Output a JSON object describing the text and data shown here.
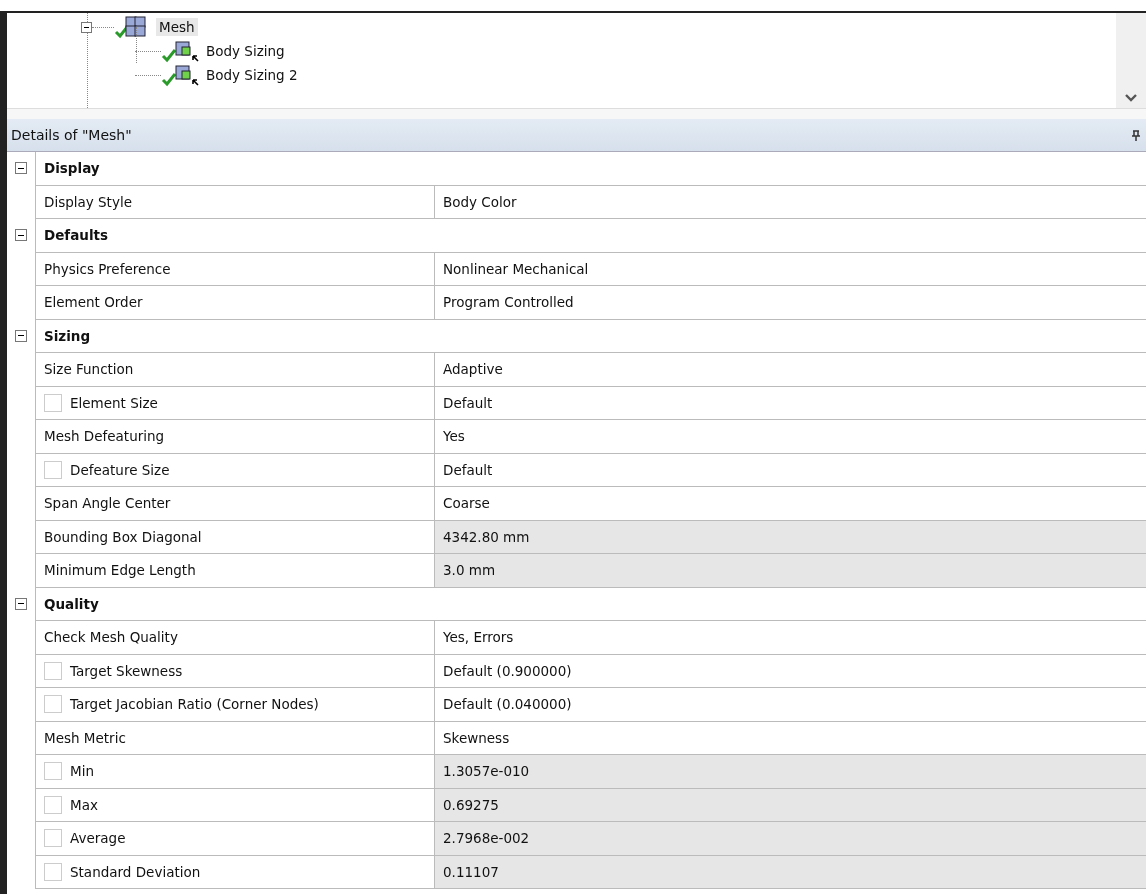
{
  "tree": {
    "items": [
      {
        "label": "Mesh",
        "selected": true,
        "expanded": true,
        "children": [
          {
            "label": "Body Sizing",
            "selected": false
          },
          {
            "label": "Body Sizing 2",
            "selected": false
          }
        ]
      }
    ]
  },
  "details": {
    "title": "Details of \"Mesh\"",
    "groups": [
      {
        "label": "Display",
        "expanded": true,
        "rows": [
          {
            "kind": "plain",
            "name": "Display Style",
            "value": "Body Color",
            "readonly": false
          }
        ]
      },
      {
        "label": "Defaults",
        "expanded": true,
        "rows": [
          {
            "kind": "plain",
            "name": "Physics Preference",
            "value": "Nonlinear Mechanical",
            "readonly": false
          },
          {
            "kind": "plain",
            "name": "Element Order",
            "value": "Program Controlled",
            "readonly": false
          }
        ]
      },
      {
        "label": "Sizing",
        "expanded": true,
        "rows": [
          {
            "kind": "plain",
            "name": "Size Function",
            "value": "Adaptive",
            "readonly": false
          },
          {
            "kind": "checkbox",
            "checked": false,
            "name": "Element Size",
            "value": "Default",
            "readonly": false
          },
          {
            "kind": "plain",
            "name": "Mesh Defeaturing",
            "value": "Yes",
            "readonly": false
          },
          {
            "kind": "checkbox",
            "checked": false,
            "name": "Defeature Size",
            "value": "Default",
            "readonly": false
          },
          {
            "kind": "plain",
            "name": "Span Angle Center",
            "value": "Coarse",
            "readonly": false
          },
          {
            "kind": "plain",
            "name": "Bounding Box Diagonal",
            "value": "4342.80 mm",
            "readonly": true
          },
          {
            "kind": "plain",
            "name": "Minimum Edge Length",
            "value": "3.0 mm",
            "readonly": true
          }
        ]
      },
      {
        "label": "Quality",
        "expanded": true,
        "rows": [
          {
            "kind": "plain",
            "name": "Check Mesh Quality",
            "value": "Yes, Errors",
            "readonly": false
          },
          {
            "kind": "checkbox",
            "checked": false,
            "name": "Target Skewness",
            "value": "Default (0.900000)",
            "readonly": false
          },
          {
            "kind": "checkbox",
            "checked": false,
            "name": "Target Jacobian Ratio (Corner Nodes)",
            "value": "Default (0.040000)",
            "readonly": false
          },
          {
            "kind": "plain",
            "name": "Mesh Metric",
            "value": "Skewness",
            "readonly": false
          },
          {
            "kind": "checkbox",
            "checked": false,
            "name": "Min",
            "value": "1.3057e-010",
            "readonly": true
          },
          {
            "kind": "checkbox",
            "checked": false,
            "name": "Max",
            "value": "0.69275",
            "readonly": true
          },
          {
            "kind": "checkbox",
            "checked": false,
            "name": "Average",
            "value": "2.7968e-002",
            "readonly": true
          },
          {
            "kind": "checkbox",
            "checked": false,
            "name": "Standard Deviation",
            "value": "0.11107",
            "readonly": true
          }
        ]
      }
    ]
  }
}
